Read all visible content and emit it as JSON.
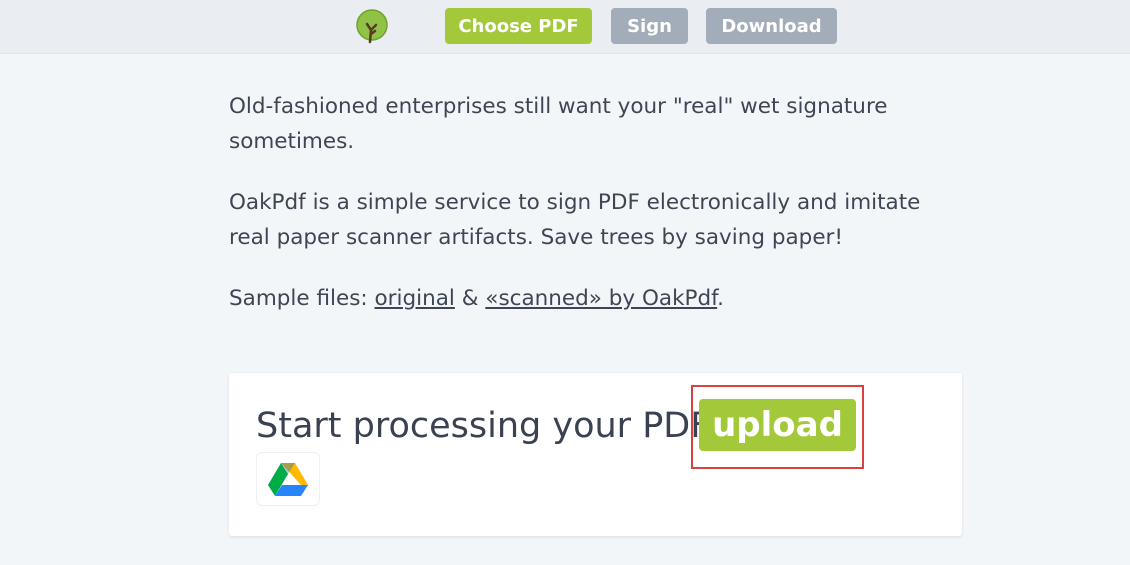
{
  "header": {
    "logo_icon": "oak-tree-icon",
    "nav": {
      "choose_pdf": "Choose PDF",
      "sign": "Sign",
      "download": "Download"
    }
  },
  "intro": {
    "p1": "Old-fashioned enterprises still want your \"real\" wet signature sometimes.",
    "p2": "OakPdf is a simple service to sign PDF electronically and imitate real paper scanner artifacts. Save trees by saving paper!",
    "samples_prefix": "Sample files: ",
    "original_link": "original",
    "amp": " & ",
    "scanned_link": "«scanned» by OakPdf",
    "suffix": "."
  },
  "uploader": {
    "prompt": "Start processing your PDF:",
    "upload_label": "upload",
    "drive_icon": "google-drive-icon"
  },
  "colors": {
    "accent_green": "#a3c93a",
    "nav_gray": "#a3acb9",
    "highlight_red": "#d94141"
  }
}
